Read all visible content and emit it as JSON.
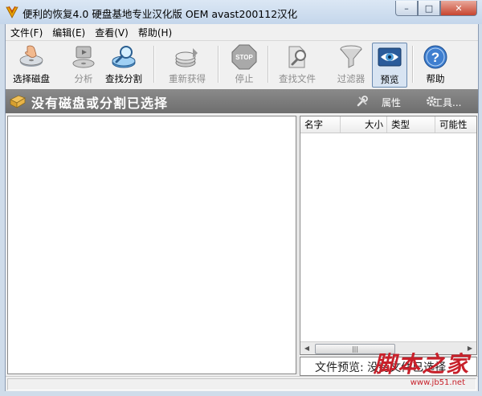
{
  "window": {
    "title": "便利的恢复4.0 硬盘基地专业汉化版 OEM avast200112汉化",
    "min_glyph": "–",
    "max_glyph": "□",
    "close_glyph": "✕"
  },
  "menu": {
    "items": [
      {
        "label": "文件(F)"
      },
      {
        "label": "编辑(E)"
      },
      {
        "label": "查看(V)"
      },
      {
        "label": "帮助(H)"
      }
    ]
  },
  "toolbar": {
    "buttons": [
      {
        "label": "选择磁盘",
        "icon": "hand-disk-icon",
        "enabled": true
      },
      {
        "label": "分析",
        "icon": "analyze-disk-icon",
        "enabled": false
      },
      {
        "label": "查找分割",
        "icon": "find-partition-icon",
        "enabled": true
      },
      {
        "label": "重新获得",
        "icon": "recover-icon",
        "enabled": false
      },
      {
        "label": "停止",
        "icon": "stop-icon",
        "enabled": false
      },
      {
        "label": "查找文件",
        "icon": "find-file-icon",
        "enabled": false
      },
      {
        "label": "过滤器",
        "icon": "filter-funnel-icon",
        "enabled": false
      },
      {
        "label": "预览",
        "icon": "preview-eye-icon",
        "enabled": true,
        "active": true
      },
      {
        "label": "帮助",
        "icon": "help-question-icon",
        "enabled": true
      }
    ],
    "stop_badge": "STOP"
  },
  "banner": {
    "status": "没有磁盘或分割已选择",
    "properties": "属性",
    "tools": "工具..."
  },
  "file_list": {
    "columns": [
      "名字",
      "大小",
      "类型",
      "可能性"
    ],
    "rows": []
  },
  "scrollbar": {
    "left_arrow": "◀",
    "right_arrow": "▶",
    "thumb_grip": "|||"
  },
  "preview": {
    "text": "文件预览: 没有文件已选择"
  },
  "watermark": {
    "brand": "脚本之家",
    "url": "www.jb51.net"
  },
  "colors": {
    "banner": "#7a7a7a",
    "window_frame": "#cfdcea",
    "watermark": "#c8202a"
  }
}
